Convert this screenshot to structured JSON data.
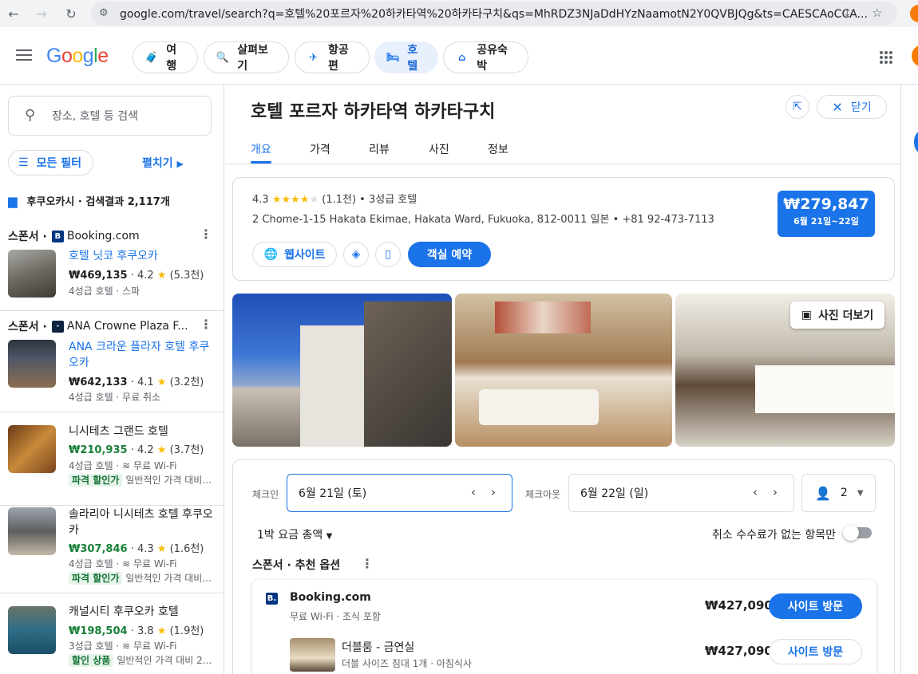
{
  "browser": {
    "url": "google.com/travel/search?q=호텔%20포르자%20하카타역%20하카타구치&qs=MhRDZ3NJaDdHYzNaamotN2Y0QVBJQg&ts=CAESCAoCCA..."
  },
  "header": {
    "logo": "Google",
    "chips": [
      "여행",
      "살펴보기",
      "항공편",
      "호텔",
      "공유숙박"
    ],
    "selected_chip": "호텔"
  },
  "left": {
    "search_placeholder": "장소, 호텔 등 검색",
    "filters_label": "모든 필터",
    "expand_label": "펼치기",
    "results_count": "후쿠오카시 · 검색결과 2,117개",
    "sponsor_label": "스폰서 ·",
    "items": [
      {
        "sponsor": "Booking.com",
        "name": "호텔 닛코 후쿠오카",
        "price": "₩469,135",
        "rating": "4.2",
        "reviews": "(5.3천)",
        "meta": "4성급 호텔 · 스파",
        "deal_tag": "",
        "deal_text": ""
      },
      {
        "sponsor": "ANA Crowne Plaza F...",
        "name": "ANA 크라운 플라자 호텔 후쿠오카",
        "price": "₩642,133",
        "rating": "4.1",
        "reviews": "(3.2천)",
        "meta": "4성급 호텔 · 무료 취소",
        "deal_tag": "",
        "deal_text": ""
      },
      {
        "sponsor": "",
        "name": "니시테츠 그랜드 호텔",
        "price": "₩210,935",
        "rating": "4.2",
        "reviews": "(3.7천)",
        "meta": "4성급 호텔 · ",
        "wifi": "무료 Wi-Fi",
        "deal_tag": "파격 할인가",
        "deal_text": "일반적인 가격 대비..."
      },
      {
        "sponsor": "",
        "name": "솔라리아 니시테츠 호텔 후쿠오카",
        "price": "₩307,846",
        "rating": "4.3",
        "reviews": "(1.6천)",
        "meta": "4성급 호텔 · ",
        "wifi": "무료 Wi-Fi",
        "deal_tag": "파격 할인가",
        "deal_text": "일반적인 가격 대비..."
      },
      {
        "sponsor": "",
        "name": "캐널시티 후쿠오카 호텔",
        "price": "₩198,504",
        "rating": "3.8",
        "reviews": "(1.9천)",
        "meta": "3성급 호텔 · ",
        "wifi": "무료 Wi-Fi",
        "deal_tag": "할인 상품",
        "deal_text": "일반적인 가격 대비 2..."
      }
    ]
  },
  "detail": {
    "title": "호텔 포르자 하카타역 하카타구치",
    "close_label": "닫기",
    "tabs": [
      "개요",
      "가격",
      "리뷰",
      "사진",
      "정보"
    ],
    "rating": "4.3",
    "reviews": "(1.1천)",
    "class": "3성급 호텔",
    "address": "2 Chome-1-15 Hakata Ekimae, Hakata Ward, Fukuoka, 812-0011 일본 • +81 92-473-7113",
    "website_label": "웹사이트",
    "book_label": "객실 예약",
    "price": "₩279,847",
    "dates": "6월 21일~22일",
    "more_photos": "사진 더보기"
  },
  "booking": {
    "checkin_label": "체크인",
    "checkin": "6월 21일 (토)",
    "checkout_label": "체크아웃",
    "checkout": "6월 22일 (일)",
    "guests": "2",
    "total_label": "1박 요금 총액",
    "nofee_label": "취소 수수료가 없는 항목만",
    "recs_label": "스폰서 · 추천 옵션",
    "offer": {
      "provider": "Booking.com",
      "sub": "무료 Wi-Fi · 조식 포함",
      "price": "₩427,090",
      "visit": "사이트 방문",
      "room_name": "더블룸 - 금연실",
      "room_sub": "더블 사이즈 침대 1개 · 아침식사",
      "room_price": "₩427,090",
      "room_visit": "사이트 방문"
    }
  },
  "colors": {
    "accent": "#1a73e8",
    "green_price": "#188038",
    "booking_blue": "#003580"
  }
}
